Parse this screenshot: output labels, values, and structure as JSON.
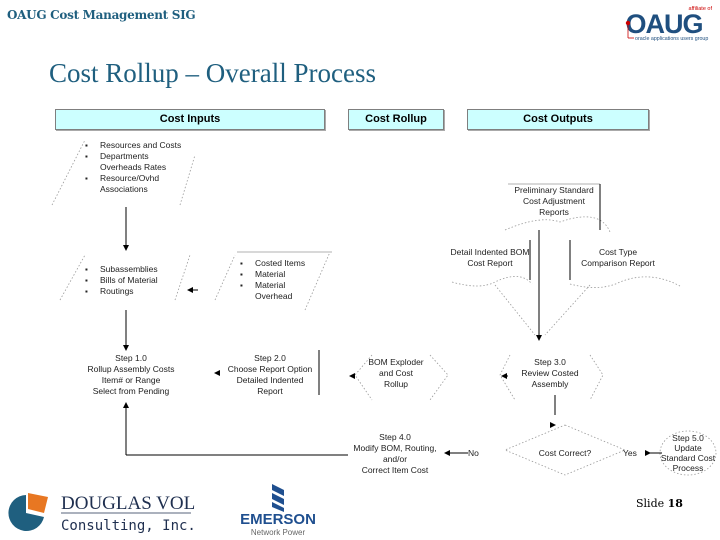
{
  "header": {
    "sig_label": "OAUG Cost Management SIG",
    "title": "Cost Rollup – Overall Process",
    "oaug_logo": {
      "tagline_top": "affiliate of",
      "wordmark": "OAUG",
      "tagline_bottom": "oracle applications users group",
      "color": "#1f4f7f",
      "accent": "#cc0000"
    }
  },
  "lanes": [
    {
      "label": "Cost Inputs"
    },
    {
      "label": "Cost Rollup"
    },
    {
      "label": "Cost Outputs"
    }
  ],
  "inputs": {
    "resources": [
      "Resources and Costs",
      "Departments Overheads Rates",
      "Resource/Ovhd Associations"
    ],
    "structures": [
      "Subassemblies",
      "Bills of Material",
      "Routings"
    ],
    "costed": [
      "Costed Items",
      "Material",
      "Material Overhead"
    ]
  },
  "steps": {
    "step1": [
      "Step 1.0",
      "Rollup Assembly Costs",
      "Item# or Range",
      "Select from Pending"
    ],
    "step2": [
      "Step 2.0",
      "Choose Report Option",
      "Detailed Indented",
      "Report"
    ],
    "bom_exploder": [
      "BOM Exploder",
      "and Cost",
      "Rollup"
    ],
    "step3": [
      "Step 3.0",
      "Review Costed",
      "Assembly"
    ],
    "step4": [
      "Step 4.0",
      "Modify BOM, Routing,",
      "and/or",
      "Correct Item Cost"
    ],
    "decision": "Cost Correct?",
    "no_label": "No",
    "yes_label": "Yes",
    "step5": [
      "Step 5.0",
      "Update",
      "Standard Cost",
      "Process"
    ]
  },
  "outputs": {
    "preliminary": [
      "Preliminary Standard",
      "Cost Adjustment",
      "Reports"
    ],
    "detail_bom": [
      "Detail Indented BOM",
      "Cost Report"
    ],
    "cost_type": [
      "Cost Type",
      "Comparison Report"
    ]
  },
  "footer": {
    "dv_logo": {
      "line1": "DOUGLAS VOLZ",
      "line2": "Consulting, Inc."
    },
    "emerson_logo": {
      "wordmark": "EMERSON",
      "sub": "Network Power",
      "color": "#1f4f8f"
    },
    "slide_prefix": "Slide",
    "slide_number": "18"
  }
}
